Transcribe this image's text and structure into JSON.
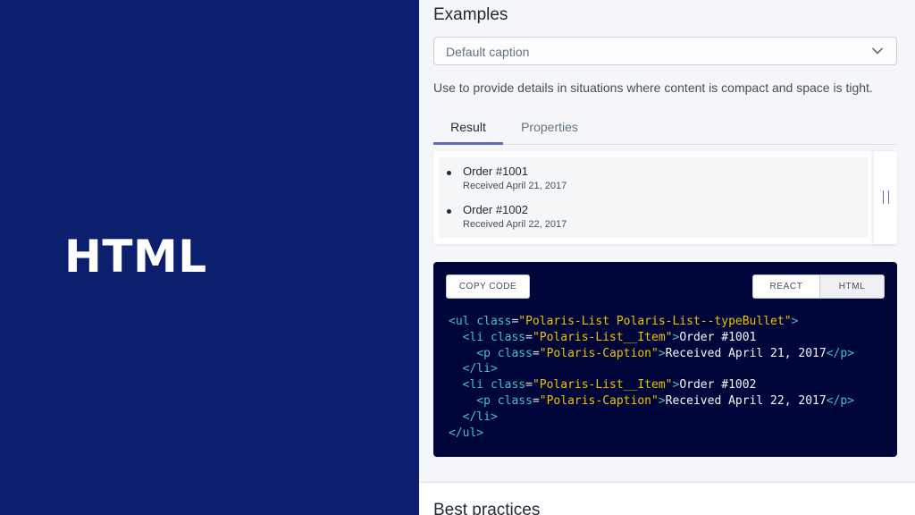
{
  "left": {
    "title": "HTML"
  },
  "examples": {
    "heading": "Examples",
    "select": {
      "value": "Default caption"
    },
    "description": "Use to provide details in situations where content is compact and space is tight."
  },
  "tabs": [
    {
      "label": "Result",
      "active": true
    },
    {
      "label": "Properties",
      "active": false
    }
  ],
  "result": {
    "items": [
      {
        "title": "Order #1001",
        "caption": "Received April 21, 2017"
      },
      {
        "title": "Order #1002",
        "caption": "Received April 22, 2017"
      }
    ]
  },
  "code_panel": {
    "copy_label": "COPY CODE",
    "toggle": {
      "react": "REACT",
      "html": "HTML",
      "selected": "HTML"
    },
    "lines": {
      "l1_open": "<ul ",
      "l1_attr": "class",
      "l1_val": "\"Polaris-List Polaris-List--typeBullet\"",
      "l1_close": ">",
      "li_open": "  <li ",
      "li_attr": "class",
      "li_val": "\"Polaris-List__Item\"",
      "li_close": ">",
      "item1_text": "Order #1001",
      "item2_text": "Order #1002",
      "p_open": "    <p ",
      "p_attr": "class",
      "p_val": "\"Polaris-Caption\"",
      "p_close": ">",
      "cap1_text": "Received April 21, 2017",
      "cap2_text": "Received April 22, 2017",
      "p_end": "</p>",
      "li_end": "  </li>",
      "ul_end": "</ul>"
    }
  },
  "best_practices": {
    "heading": "Best practices"
  },
  "colors": {
    "left_bg": "#0c1f6e",
    "code_bg": "#000639",
    "accent": "#5c6ac4",
    "code_tag": "#47c1bf",
    "code_string": "#eec200"
  }
}
